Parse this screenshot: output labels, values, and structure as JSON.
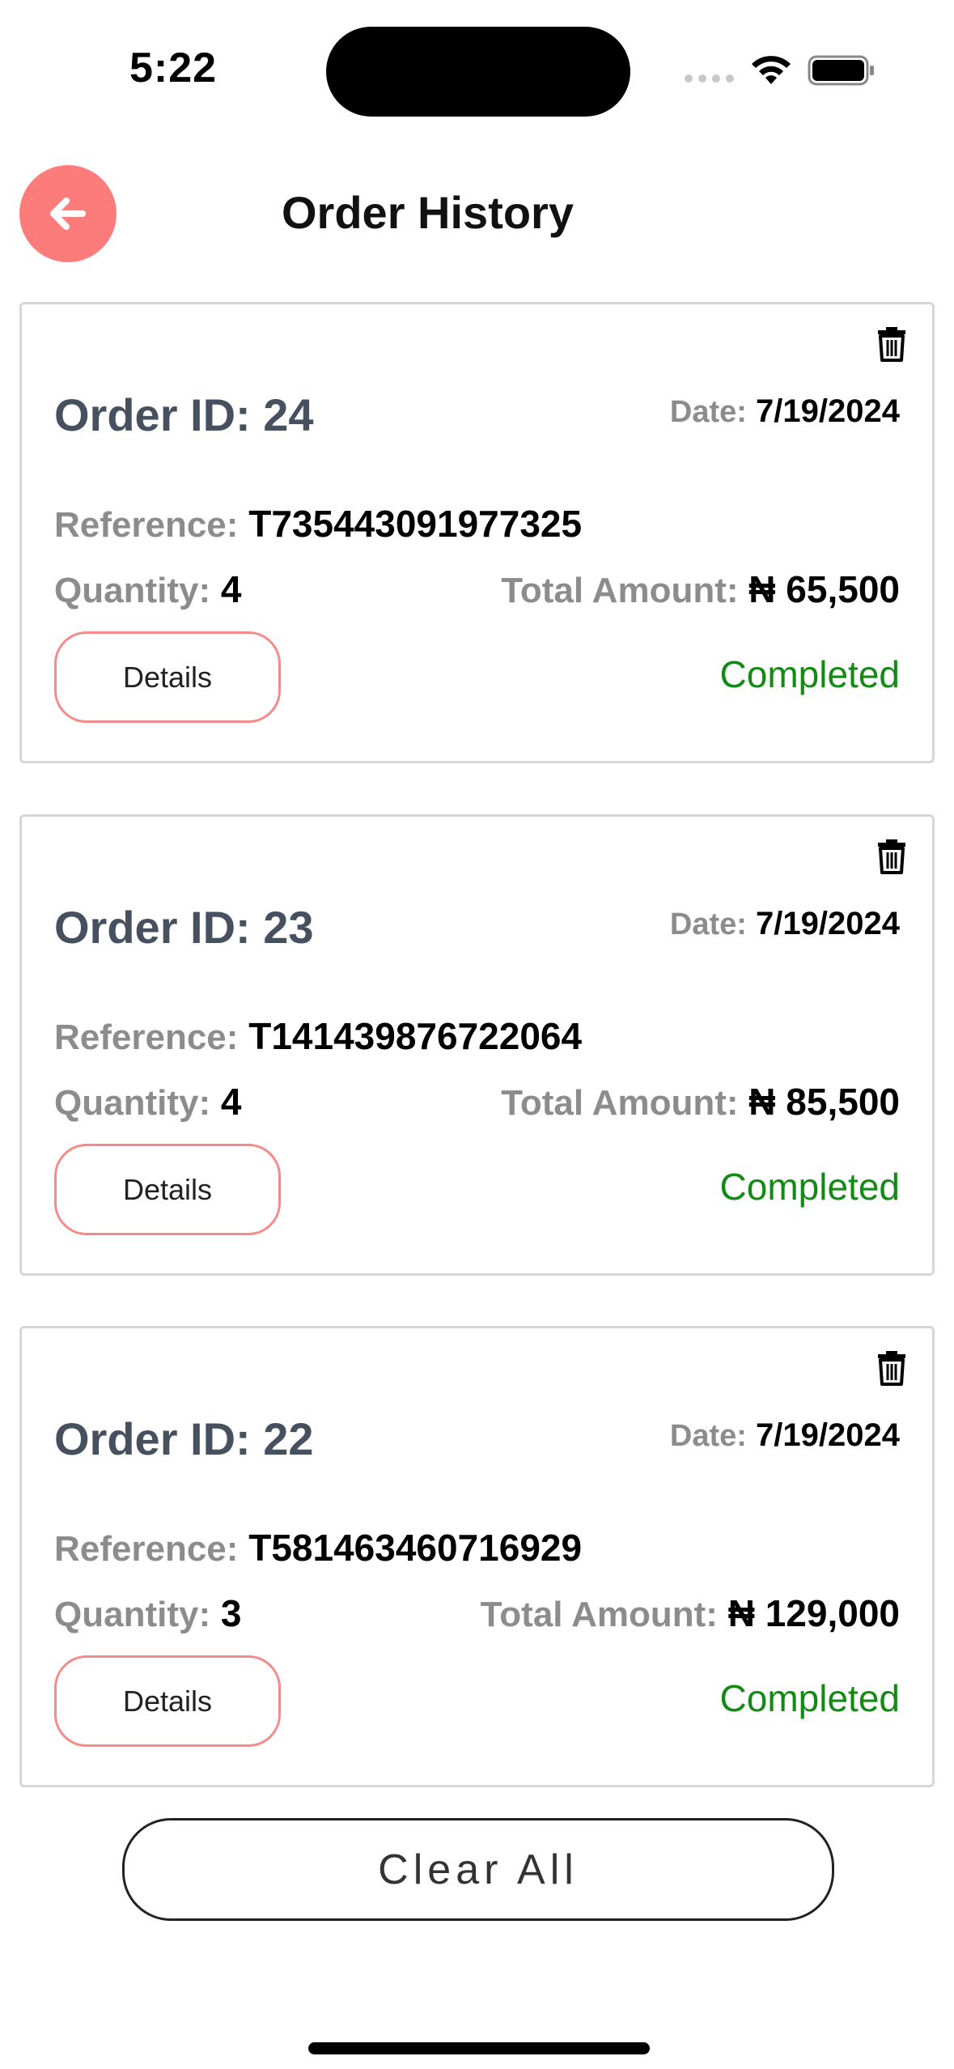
{
  "status_bar": {
    "time": "5:22"
  },
  "header": {
    "title": "Order History"
  },
  "orders": [
    {
      "order_id": "Order ID: 24",
      "date_label": "Date:",
      "date": "7/19/2024",
      "reference_label": "Reference:",
      "reference": "T735443091977325",
      "quantity_label": "Quantity:",
      "quantity": "4",
      "amount_label": "Total Amount:",
      "amount": "₦ 65,500",
      "details_label": "Details",
      "status": "Completed"
    },
    {
      "order_id": "Order ID: 23",
      "date_label": "Date:",
      "date": "7/19/2024",
      "reference_label": "Reference:",
      "reference": "T141439876722064",
      "quantity_label": "Quantity:",
      "quantity": "4",
      "amount_label": "Total Amount:",
      "amount": "₦ 85,500",
      "details_label": "Details",
      "status": "Completed"
    },
    {
      "order_id": "Order ID: 22",
      "date_label": "Date:",
      "date": "7/19/2024",
      "reference_label": "Reference:",
      "reference": "T581463460716929",
      "quantity_label": "Quantity:",
      "quantity": "3",
      "amount_label": "Total Amount:",
      "amount": "₦ 129,000",
      "details_label": "Details",
      "status": "Completed"
    }
  ],
  "footer": {
    "clear_all_label": "Clear All"
  },
  "colors": {
    "accent": "#fc7b7b",
    "status_completed": "#138a13",
    "order_id": "#47505f"
  },
  "icons": {
    "back": "arrow-left-icon",
    "delete": "trash-icon"
  }
}
